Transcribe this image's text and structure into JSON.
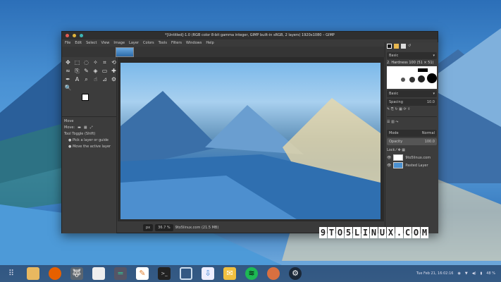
{
  "window": {
    "title": "*[Untitled]-1.0 (RGB color 8-bit gamma integer, GIMP built-in sRGB, 2 layers) 1920x1080 – GIMP",
    "menu": [
      "File",
      "Edit",
      "Select",
      "View",
      "Image",
      "Layer",
      "Colors",
      "Tools",
      "Filters",
      "Windows",
      "Help"
    ]
  },
  "tool_options": {
    "title": "Move",
    "move_label": "Move:",
    "toggle": "Tool Toggle (Shift)",
    "option1": "Pick a layer or guide",
    "option2": "Move the active layer"
  },
  "brushes": {
    "filter": "Basic",
    "name": "2. Hardness 100 (51 × 51)",
    "preset": "Basic",
    "spacing_label": "Spacing",
    "spacing": "10.0"
  },
  "layers": {
    "mode_label": "Mode",
    "mode": "Normal",
    "opacity_label": "Opacity",
    "opacity": "100.0",
    "lock_label": "Lock",
    "items": [
      "9to5linux.com",
      "Pasted Layer"
    ]
  },
  "status": {
    "unit": "px",
    "zoom": "36.7 %",
    "info": "9to5linux.com (21.5 MB)"
  },
  "watermark": "9TO5LINUX.COM",
  "taskbar": {
    "apps": [
      "app-launcher",
      "files",
      "firefox",
      "gimp-wilber",
      "writer",
      "calculator",
      "text-editor",
      "terminal",
      "screenshot",
      "store",
      "mail",
      "spotify",
      "inkscape",
      "steam"
    ],
    "clock": "Tue Feb 21, 16:02:16",
    "battery": "48 %"
  }
}
